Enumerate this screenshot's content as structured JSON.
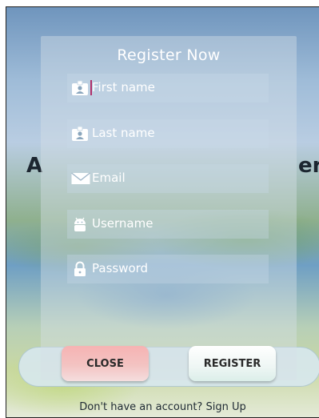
{
  "background": {
    "title_left": "A",
    "title_right": "er",
    "signup_link": "Don't have an account? Sign Up"
  },
  "dialog": {
    "title": "Register Now",
    "fields": [
      {
        "icon": "contact-card-icon",
        "placeholder": "First name"
      },
      {
        "icon": "contact-card-icon",
        "placeholder": "Last name"
      },
      {
        "icon": "envelope-icon",
        "placeholder": "Email"
      },
      {
        "icon": "android-icon",
        "placeholder": "Username"
      },
      {
        "icon": "lock-icon",
        "placeholder": "Password"
      }
    ],
    "close_label": "CLOSE",
    "register_label": "REGISTER"
  },
  "colors": {
    "close_button": "#f6b3b3",
    "register_button": "#eef6f4",
    "cursor": "#b0306a"
  }
}
